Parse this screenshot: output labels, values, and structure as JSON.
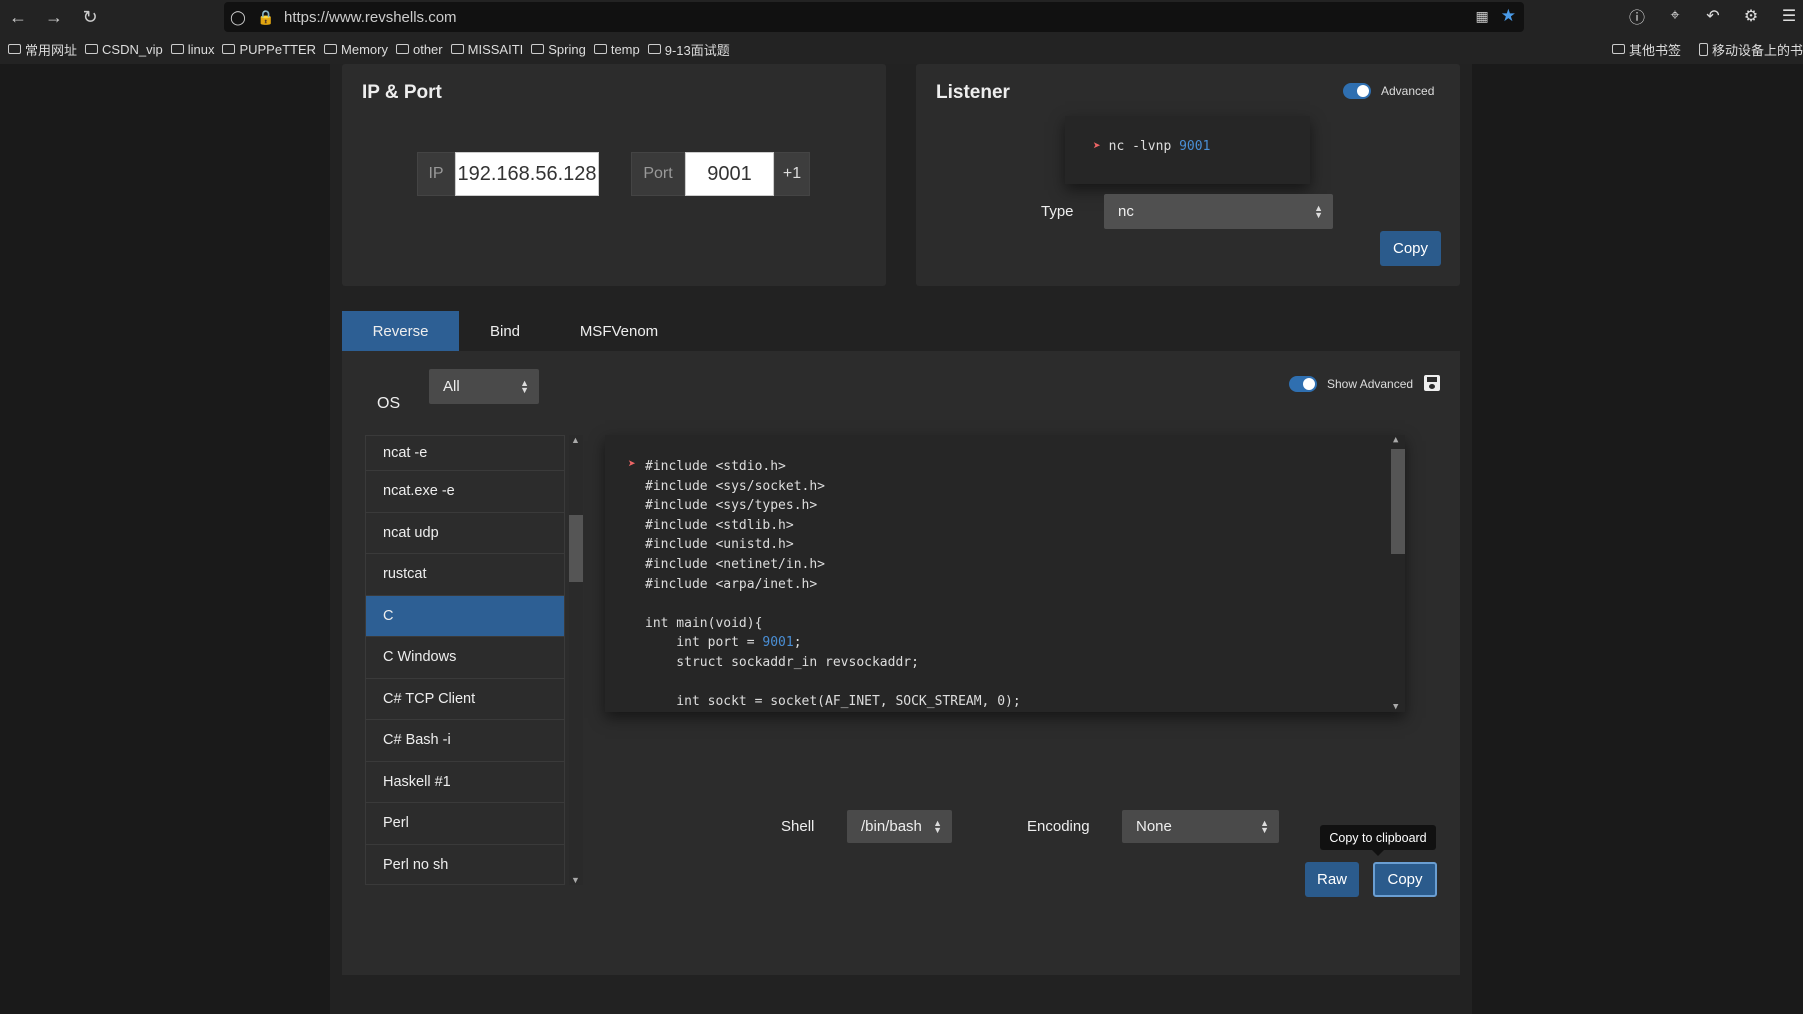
{
  "browser": {
    "url": "https://www.revshells.com",
    "bookmarks": [
      "常用网址",
      "CSDN_vip",
      "linux",
      "PUPPeTTER",
      "Memory",
      "other",
      "MISSAITI",
      "Spring",
      "temp",
      "9-13面试题"
    ],
    "bookmarks_right": [
      "其他书签",
      "移动设备上的书"
    ]
  },
  "ipport": {
    "title": "IP & Port",
    "ip_label": "IP",
    "ip_value": "192.168.56.128",
    "port_label": "Port",
    "port_value": "9001",
    "increment": "+1"
  },
  "listener": {
    "title": "Listener",
    "advanced_label": "Advanced",
    "command_prefix": "nc -lvnp ",
    "command_port": "9001",
    "type_label": "Type",
    "type_value": "nc",
    "copy_label": "Copy"
  },
  "tabs": [
    "Reverse",
    "Bind",
    "MSFVenom"
  ],
  "reverse": {
    "os_label": "OS",
    "os_value": "All",
    "show_advanced_label": "Show Advanced",
    "items": [
      "ncat -e",
      "ncat.exe -e",
      "ncat udp",
      "rustcat",
      "C",
      "C Windows",
      "C# TCP Client",
      "C# Bash -i",
      "Haskell #1",
      "Perl",
      "Perl no sh"
    ],
    "selected": "C",
    "code_lines": [
      "#include <stdio.h>",
      "#include <sys/socket.h>",
      "#include <sys/types.h>",
      "#include <stdlib.h>",
      "#include <unistd.h>",
      "#include <netinet/in.h>",
      "#include <arpa/inet.h>",
      "",
      "int main(void){",
      "    int port = ",
      "    struct sockaddr_in revsockaddr;",
      "",
      "    int sockt = socket(AF_INET, SOCK_STREAM, 0);"
    ],
    "code_port": "9001",
    "shell_label": "Shell",
    "shell_value": "/bin/bash",
    "encoding_label": "Encoding",
    "encoding_value": "None",
    "raw_label": "Raw",
    "copy_label": "Copy",
    "tooltip": "Copy to clipboard"
  },
  "colors": {
    "accent": "#2d5f94",
    "port_highlight": "#4a8fd6"
  }
}
